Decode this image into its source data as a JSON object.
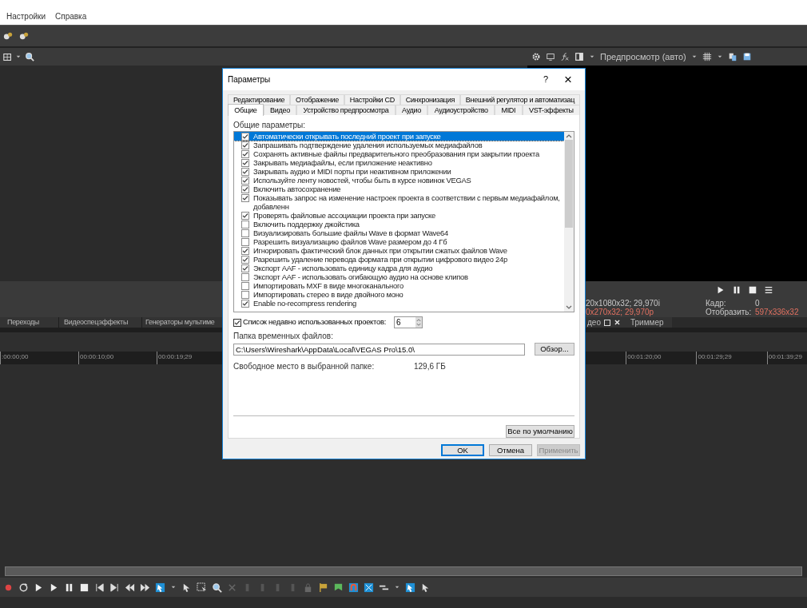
{
  "menu_bar": {
    "items": [
      "Настройки",
      "Справка"
    ]
  },
  "preview": {
    "mode": "Предпросмотр (авто)",
    "info": [
      {
        "kind": "plain",
        "text": "20x1080x32; 29,970i"
      },
      {
        "kind": "accent",
        "text": "0x270x32; 29,970p"
      }
    ],
    "stats": [
      {
        "label": "Кадр:",
        "value": "0",
        "kind": "plain"
      },
      {
        "label": "Отобразить:",
        "value": "597x336x32",
        "kind": "accent"
      }
    ]
  },
  "left_tabs": [
    "Переходы",
    "Видеоспецэффекты",
    "Генераторы мультиме"
  ],
  "right_tabs": [
    {
      "label": "део",
      "closable": true
    },
    {
      "label": "Триммер",
      "closable": false
    }
  ],
  "timeline": {
    "left_ticks": [
      ":00:00;00",
      "00:00:10;00",
      "00:00:19;29"
    ],
    "right_ticks": [
      "00:01:20;00",
      "00:01:29;29",
      "00:01:39;29"
    ]
  },
  "dialog": {
    "title": "Параметры",
    "help": "?",
    "close": "×",
    "tab_rows": [
      [
        {
          "label": "Редактирование",
          "selected": false
        },
        {
          "label": "Отображение",
          "selected": false
        },
        {
          "label": "Настройки CD",
          "selected": false
        },
        {
          "label": "Синхронизация",
          "selected": false
        },
        {
          "label": "Внешний регулятор и автоматизац",
          "selected": false
        }
      ],
      [
        {
          "label": "Общие",
          "selected": true
        },
        {
          "label": "Видео",
          "selected": false
        },
        {
          "label": "Устройство предпросмотра",
          "selected": false
        },
        {
          "label": "Аудио",
          "selected": false
        },
        {
          "label": "Аудиоустройство",
          "selected": false
        },
        {
          "label": "MIDI",
          "selected": false
        },
        {
          "label": "VST-эффекты",
          "selected": false
        }
      ]
    ],
    "group_label": "Общие параметры:",
    "options": [
      {
        "label": "Автоматически открывать последний проект при запуске",
        "checked": true,
        "selected": true
      },
      {
        "label": "Запрашивать подтверждение удаления используемых медиафайлов",
        "checked": true,
        "selected": false
      },
      {
        "label": "Сохранять активные файлы предварительного преобразования при закрытии проекта",
        "checked": true,
        "selected": false
      },
      {
        "label": "Закрывать медиафайлы, если приложение неактивно",
        "checked": true,
        "selected": false
      },
      {
        "label": "Закрывать аудио и MIDI порты при неактивном приложении",
        "checked": true,
        "selected": false
      },
      {
        "label": "Используйте ленту новостей, чтобы быть в курсе новинок VEGAS",
        "checked": true,
        "selected": false
      },
      {
        "label": "Включить автосохранение",
        "checked": true,
        "selected": false
      },
      {
        "label": "Показывать запрос на изменение настроек проекта в соответствии с первым медиафайлом, добавленн",
        "checked": true,
        "selected": false
      },
      {
        "label": "Проверять файловые ассоциации проекта при запуске",
        "checked": true,
        "selected": false
      },
      {
        "label": "Включить поддержку джойстика",
        "checked": false,
        "selected": false
      },
      {
        "label": "Визуализировать большие файлы Wave в формат Wave64",
        "checked": false,
        "selected": false
      },
      {
        "label": "Разрешить визуализацию файлов Wave размером до 4 Гб",
        "checked": false,
        "selected": false
      },
      {
        "label": "Игнорировать фактический блок данных при открытии сжатых файлов Wave",
        "checked": true,
        "selected": false
      },
      {
        "label": "Разрешить удаление перевода формата при открытии цифрового видео 24p",
        "checked": true,
        "selected": false
      },
      {
        "label": "Экспорт AAF - использовать единицу кадра для аудио",
        "checked": true,
        "selected": false
      },
      {
        "label": "Экспорт AAF - использовать огибающую аудио на основе клипов",
        "checked": false,
        "selected": false
      },
      {
        "label": "Импортировать MXF в виде многоканального",
        "checked": false,
        "selected": false
      },
      {
        "label": "Импортировать стерео в виде двойного моно",
        "checked": false,
        "selected": false
      },
      {
        "label": "Enable no-recompress rendering",
        "checked": true,
        "selected": false
      }
    ],
    "recent": {
      "label": "Список недавно использованных проектов:",
      "checked": true,
      "value": "6"
    },
    "temp_folder": {
      "label": "Папка временных файлов:",
      "value": "C:\\Users\\Wireshark\\AppData\\Local\\VEGAS Pro\\15.0\\",
      "browse": "Обзор..."
    },
    "free_space": {
      "label": "Свободное место в выбранной папке:",
      "value": "129,6 ГБ"
    },
    "defaults_button": "Все по умолчанию",
    "buttons": [
      {
        "label": "OK",
        "kind": "default"
      },
      {
        "label": "Отмена",
        "kind": "normal"
      },
      {
        "label": "Применить",
        "kind": "disabled"
      }
    ]
  }
}
